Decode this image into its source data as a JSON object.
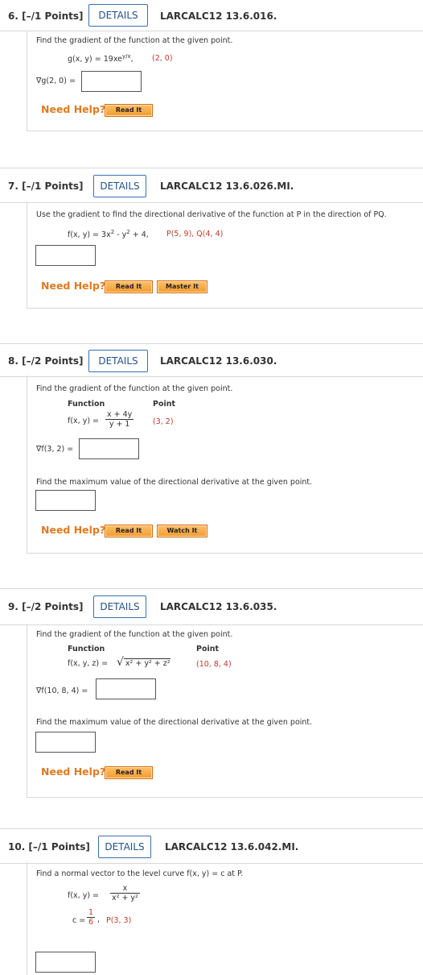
{
  "questions": [
    {
      "num": "6. [–/1 Points]",
      "details": "DETAILS",
      "code": "LARCALC12 13.6.016.",
      "prompt": "Find the gradient of the function at the given point.",
      "func_left": "g(x, y) = 19xe",
      "func_exp": "y/x",
      "func_point": "(2, 0)",
      "answer_label": "∇g(2, 0) =",
      "help_label": "Need Help?",
      "buttons": [
        "Read It"
      ]
    },
    {
      "num": "7. [–/1 Points]",
      "details": "DETAILS",
      "code": "LARCALC12 13.6.026.MI.",
      "prompt": "Use the gradient to find the directional derivative of the function at P in the direction of PQ.",
      "func": "f(x, y) = 3x",
      "func_rest": " - y",
      "func_rest2": " + 4,",
      "func_points": "P(5, 9), Q(4, 4)",
      "help_label": "Need Help?",
      "buttons": [
        "Read It",
        "Master It"
      ]
    },
    {
      "num": "8. [–/2 Points]",
      "details": "DETAILS",
      "code": "LARCALC12 13.6.030.",
      "prompt": "Find the gradient of the function at the given point.",
      "col_function": "Function",
      "col_point": "Point",
      "func_lhs": "f(x, y) =",
      "frac_num": "x + 4y",
      "frac_den": "y + 1",
      "point": "(3, 2)",
      "answer_label": "∇f(3, 2) =",
      "prompt2": "Find the maximum value of the directional derivative at the given point.",
      "help_label": "Need Help?",
      "buttons": [
        "Read It",
        "Watch It"
      ]
    },
    {
      "num": "9. [–/2 Points]",
      "details": "DETAILS",
      "code": "LARCALC12 13.6.035.",
      "prompt": "Find the gradient of the function at the given point.",
      "col_function": "Function",
      "col_point": "Point",
      "func_lhs": "f(x, y, z) =",
      "sqrt_inner": "x² + y² + z²",
      "point": "(10, 8, 4)",
      "answer_label": "∇f(10, 8, 4) =",
      "prompt2": "Find the maximum value of the directional derivative at the given point.",
      "help_label": "Need Help?",
      "buttons": [
        "Read It"
      ]
    },
    {
      "num": "10. [–/1 Points]",
      "details": "DETAILS",
      "code": "LARCALC12 13.6.042.MI.",
      "prompt": "Find a normal vector to the level curve f(x, y) = c at P.",
      "func_lhs": "f(x, y) =",
      "frac_num": "x",
      "frac_den": "x² + y²",
      "c_lhs": "c =",
      "c_num": "1",
      "c_den": "6",
      "point": "P(3, 3)"
    }
  ]
}
